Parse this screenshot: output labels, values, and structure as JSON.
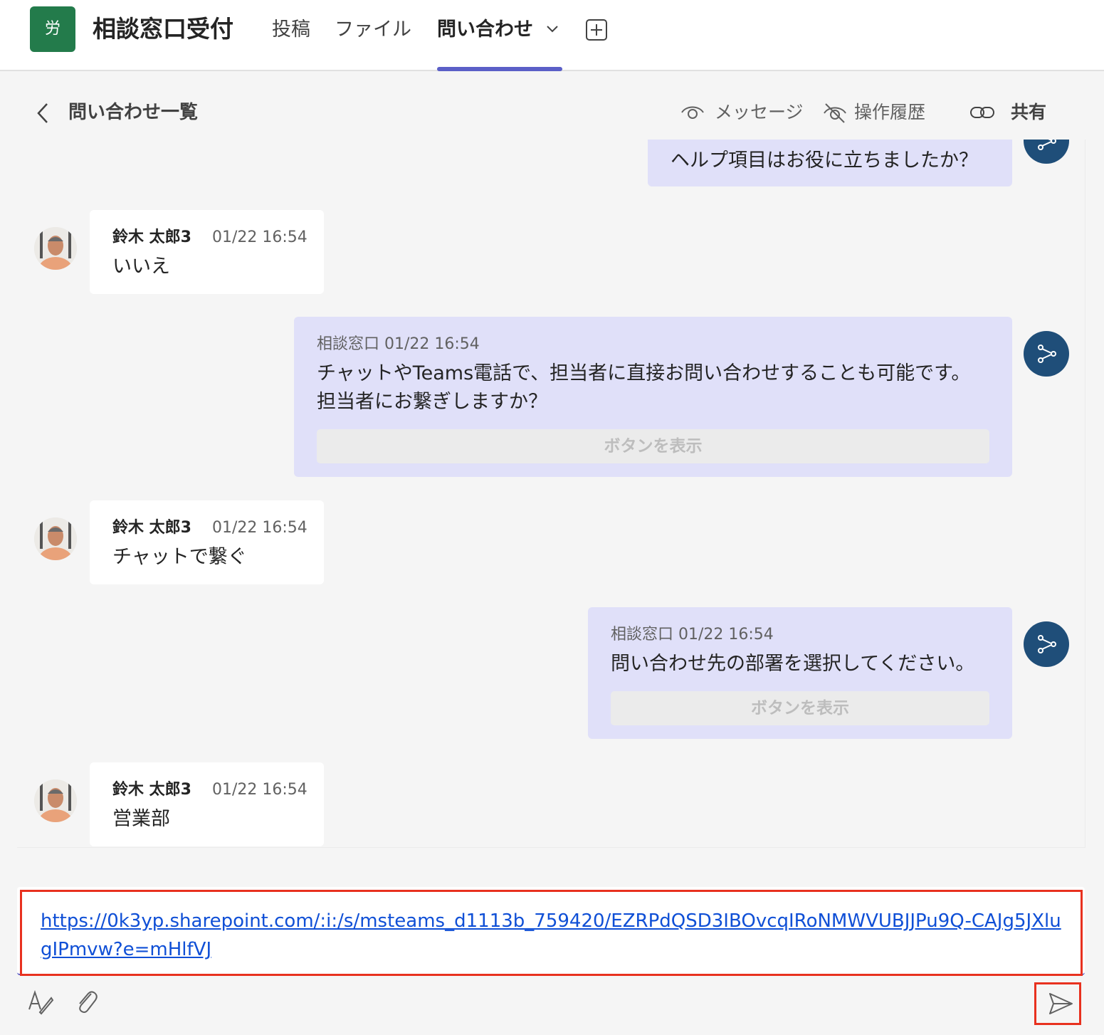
{
  "header": {
    "team_avatar_text": "労",
    "channel_title": "相談窓口受付",
    "tabs": [
      {
        "label": "投稿"
      },
      {
        "label": "ファイル"
      },
      {
        "label": "問い合わせ"
      }
    ]
  },
  "subheader": {
    "back_title": "問い合わせ一覧",
    "actions": [
      {
        "label": "メッセージ",
        "icon": "eye-icon"
      },
      {
        "label": "操作履歴",
        "icon": "eye-off-icon"
      },
      {
        "label": "共有",
        "icon": "link-icon"
      }
    ]
  },
  "messages": [
    {
      "from": "bot",
      "text": "ヘルプ項目はお役に立ちましたか？"
    },
    {
      "from": "user",
      "name": "鈴木 太郎3",
      "time": "01/22 16:54",
      "text": "いいえ"
    },
    {
      "from": "bot",
      "sender": "相談窓口 01/22 16:54",
      "lines": [
        "チャットやTeams電話で、担当者に直接お問い合わせすることも可能です。",
        "担当者にお繋ぎしますか？"
      ],
      "button": "ボタンを表示"
    },
    {
      "from": "user",
      "name": "鈴木 太郎3",
      "time": "01/22 16:54",
      "text": "チャットで繋ぐ"
    },
    {
      "from": "bot",
      "sender": "相談窓口 01/22 16:54",
      "lines": [
        "問い合わせ先の部署を選択してください。"
      ],
      "button": "ボタンを表示"
    },
    {
      "from": "user",
      "name": "鈴木 太郎3",
      "time": "01/22 16:54",
      "text": "営業部"
    }
  ],
  "composer": {
    "link_text": "https://0k3yp.sharepoint.com/:i:/s/msteams_d1113b_759420/EZRPdQSD3IBOvcqIRoNMWVUBJJPu9Q-CAJg5JXlugIPmvw?e=mHlfVJ"
  },
  "colors": {
    "accent": "#5b5fc7",
    "bot_bubble": "#e0e0f9",
    "bot_icon": "#1f4e79",
    "team_avatar": "#237b4b",
    "highlight": "#e8311f",
    "link": "#0f4fd6"
  }
}
